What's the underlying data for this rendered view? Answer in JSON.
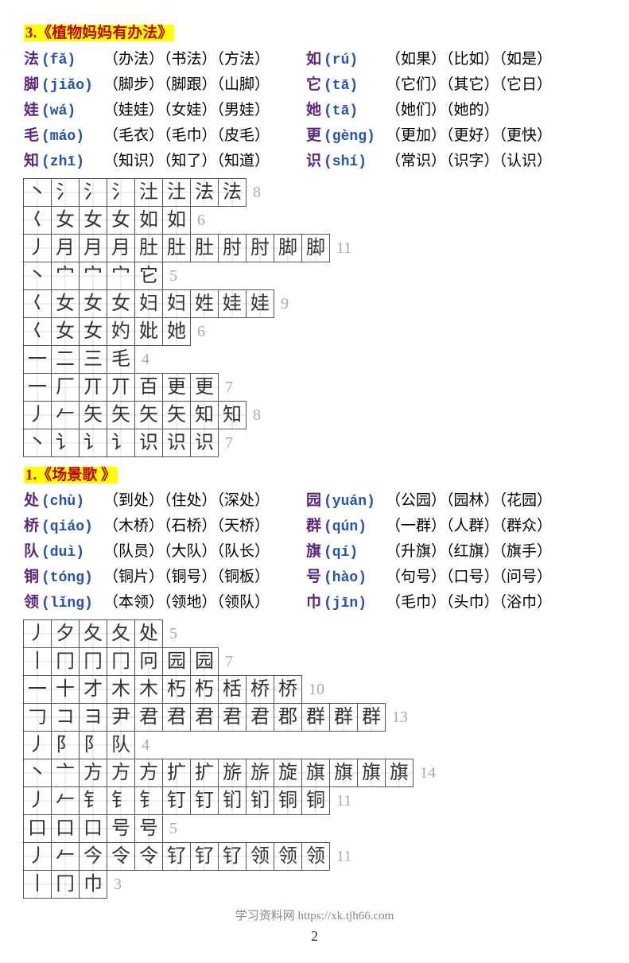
{
  "sections": [
    {
      "title": "3.《植物妈妈有办法》",
      "words": [
        {
          "left": {
            "char": "法",
            "pinyin": "(fǎ)",
            "words": "（办法）（书法）（方法）"
          },
          "right": {
            "char": "如",
            "pinyin": "(rú)",
            "words": "（如果）（比如）（如是）"
          }
        },
        {
          "left": {
            "char": "脚",
            "pinyin": "(jiǎo)",
            "words": "（脚步）（脚跟）（山脚）"
          },
          "right": {
            "char": "它",
            "pinyin": "(tā)",
            "words": "（它们）（其它）（它日）"
          }
        },
        {
          "left": {
            "char": "娃",
            "pinyin": "(wá)",
            "words": "（娃娃）（女娃）（男娃）"
          },
          "right": {
            "char": "她",
            "pinyin": "(tā)",
            "words": "（她们）（她的）"
          }
        },
        {
          "left": {
            "char": "毛",
            "pinyin": "(máo)",
            "words": "（毛衣）（毛巾）（皮毛）"
          },
          "right": {
            "char": "更",
            "pinyin": "(gèng)",
            "words": "（更加）（更好）（更快）"
          }
        },
        {
          "left": {
            "char": "知",
            "pinyin": "(zhī)",
            "words": "（知识）（知了）（知道）"
          },
          "right": {
            "char": "识",
            "pinyin": "(shí)",
            "words": "（常识）（识字）（认识）"
          }
        }
      ],
      "strokes": [
        {
          "cells": [
            "丶",
            "氵",
            "氵",
            "氵",
            "汢",
            "汢",
            "法",
            "法"
          ],
          "count": 8
        },
        {
          "cells": [
            "𡿨",
            "女",
            "女",
            "女",
            "如",
            "如"
          ],
          "count": 6
        },
        {
          "cells": [
            "丿",
            "月",
            "月",
            "月",
            "肚",
            "肚",
            "肚",
            "肘",
            "肘",
            "脚",
            "脚"
          ],
          "count": 11
        },
        {
          "cells": [
            "丶",
            "宀",
            "宀",
            "宀",
            "它"
          ],
          "count": 5
        },
        {
          "cells": [
            "𡿨",
            "女",
            "女",
            "女",
            "妇",
            "妇",
            "姓",
            "娃",
            "娃"
          ],
          "count": 9
        },
        {
          "cells": [
            "𡿨",
            "女",
            "女",
            "妁",
            "妣",
            "她"
          ],
          "count": 6
        },
        {
          "cells": [
            "一",
            "二",
            "三",
            "毛"
          ],
          "count": 4
        },
        {
          "cells": [
            "一",
            "厂",
            "丌",
            "丌",
            "百",
            "更",
            "更"
          ],
          "count": 7
        },
        {
          "cells": [
            "丿",
            "𠂉",
            "矢",
            "矢",
            "矢",
            "矢",
            "知",
            "知"
          ],
          "count": 8
        },
        {
          "cells": [
            "丶",
            "讠",
            "讠",
            "讠",
            "识",
            "识",
            "识"
          ],
          "count": 7
        }
      ]
    },
    {
      "title": "1.《场景歌 》",
      "words": [
        {
          "left": {
            "char": "处",
            "pinyin": "(chù)",
            "words": "（到处）（住处）（深处）"
          },
          "right": {
            "char": "园",
            "pinyin": "(yuán)",
            "words": "（公园）（园林）（花园）"
          }
        },
        {
          "left": {
            "char": "桥",
            "pinyin": "(qiáo)",
            "words": "（木桥）（石桥）（天桥）"
          },
          "right": {
            "char": "群",
            "pinyin": "(qún)",
            "words": "（一群）（人群）（群众）"
          }
        },
        {
          "left": {
            "char": "队",
            "pinyin": "(duì)",
            "words": "（队员）（大队）（队长）"
          },
          "right": {
            "char": "旗",
            "pinyin": "(qí)",
            "words": "（升旗）（红旗）（旗手）"
          }
        },
        {
          "left": {
            "char": "铜",
            "pinyin": "(tóng)",
            "words": "（铜片）（铜号）（铜板）"
          },
          "right": {
            "char": "号",
            "pinyin": "(hào)",
            "words": "（句号）（口号）（问号）"
          }
        },
        {
          "left": {
            "char": "领",
            "pinyin": "(lǐng)",
            "words": "（本领）（领地）（领队）"
          },
          "right": {
            "char": "巾",
            "pinyin": " (jīn)",
            "words": "（毛巾）（头巾）（浴巾）"
          }
        }
      ],
      "strokes": [
        {
          "cells": [
            "丿",
            "夕",
            "夂",
            "夂",
            "处"
          ],
          "count": 5
        },
        {
          "cells": [
            "丨",
            "冂",
            "冂",
            "冂",
            "冋",
            "园",
            "园"
          ],
          "count": 7
        },
        {
          "cells": [
            "一",
            "十",
            "才",
            "木",
            "木",
            "朽",
            "朽",
            "栝",
            "桥",
            "桥"
          ],
          "count": 10
        },
        {
          "cells": [
            "𠃌",
            "コ",
            "ヨ",
            "尹",
            "君",
            "君",
            "君",
            "君",
            "君",
            "郡",
            "群",
            "群",
            "群"
          ],
          "count": 13
        },
        {
          "cells": [
            "丿",
            "阝",
            "阝",
            "队"
          ],
          "count": 4
        },
        {
          "cells": [
            "丶",
            "亠",
            "方",
            "方",
            "方",
            "扩",
            "扩",
            "旂",
            "旂",
            "旋",
            "旗",
            "旗",
            "旗",
            "旗"
          ],
          "count": 14
        },
        {
          "cells": [
            "丿",
            "𠂉",
            "钅",
            "钅",
            "钅",
            "钉",
            "钉",
            "钔",
            "钔",
            "铜",
            "铜"
          ],
          "count": 11
        },
        {
          "cells": [
            "口",
            "口",
            "口",
            "号",
            "号"
          ],
          "count": 5
        },
        {
          "cells": [
            "丿",
            "𠂉",
            "今",
            "令",
            "令",
            "钌",
            "钌",
            "钌",
            "领",
            "领",
            "领"
          ],
          "count": 11
        },
        {
          "cells": [
            "丨",
            "冂",
            "巾"
          ],
          "count": 3
        }
      ]
    }
  ],
  "footer": "学习资料网 https://xk.tjh66.com",
  "page_number": "2"
}
